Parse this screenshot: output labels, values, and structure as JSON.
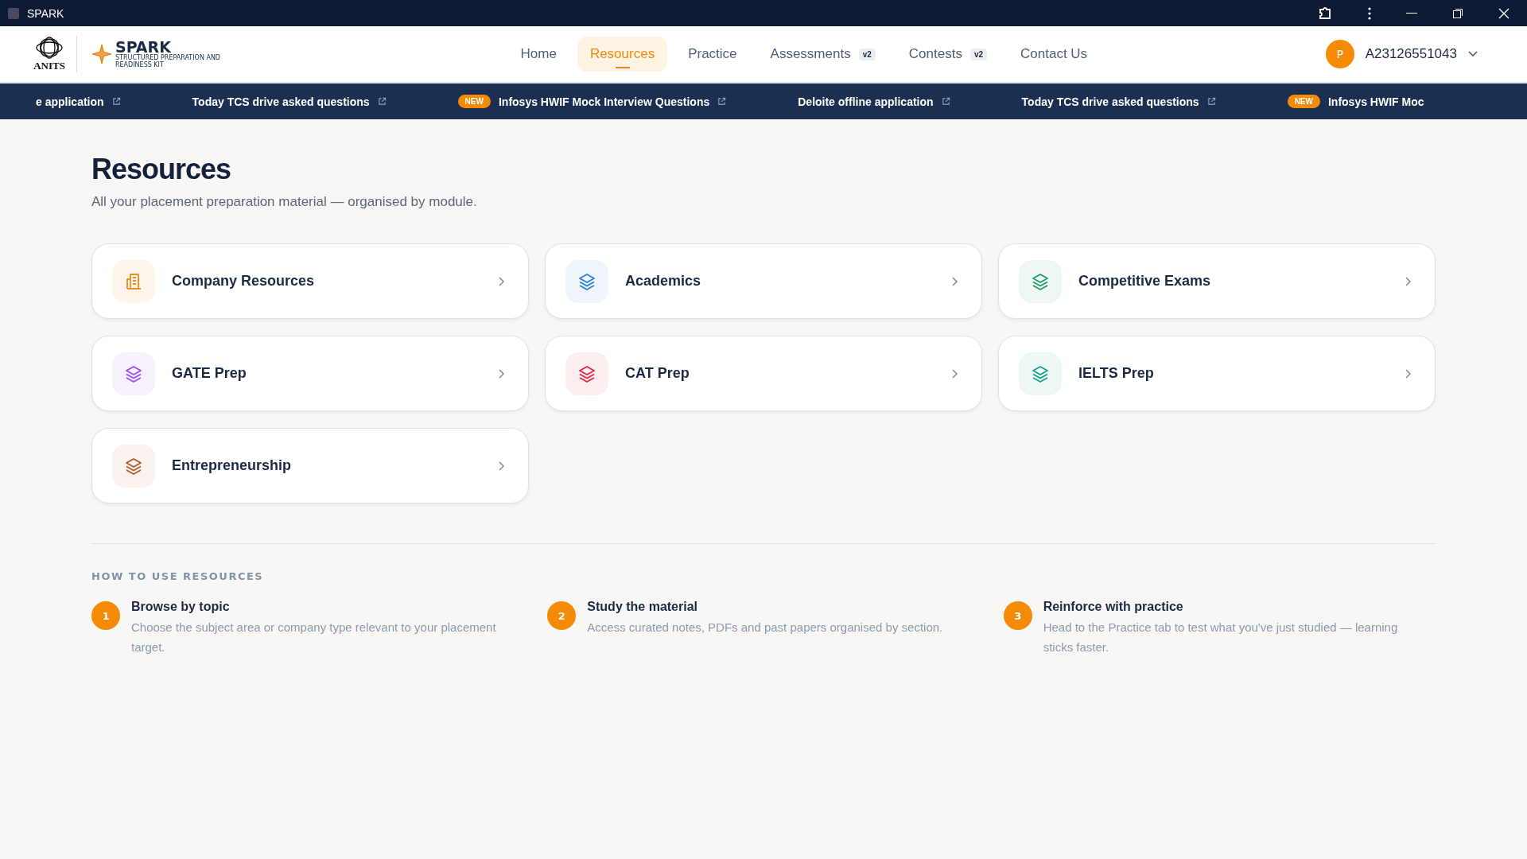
{
  "window": {
    "title": "SPARK"
  },
  "header": {
    "logo_text": "ANITS",
    "brand": "SPARK",
    "brand_tagline": "STRUCTURED PREPARATION AND READINESS KIT",
    "nav": [
      {
        "label": "Home",
        "selected": false
      },
      {
        "label": "Resources",
        "selected": true
      },
      {
        "label": "Practice",
        "selected": false
      },
      {
        "label": "Assessments",
        "selected": false,
        "badge": "v2"
      },
      {
        "label": "Contests",
        "selected": false,
        "badge": "v2"
      },
      {
        "label": "Contact Us",
        "selected": false
      }
    ],
    "user": {
      "initial": "P",
      "id": "A23126551043"
    }
  },
  "ticker": [
    {
      "text": "e application",
      "new": false,
      "link": true
    },
    {
      "text": "Today TCS drive asked questions",
      "new": false,
      "link": true
    },
    {
      "text": "Infosys HWIF Mock Interview Questions",
      "new": true,
      "badge": "NEW",
      "link": true
    },
    {
      "text": "Deloite offline application",
      "new": false,
      "link": true
    },
    {
      "text": "Today TCS drive asked questions",
      "new": false,
      "link": true
    },
    {
      "text": "Infosys HWIF Moc",
      "new": true,
      "badge": "NEW",
      "link": false
    }
  ],
  "page": {
    "title": "Resources",
    "subtitle": "All your placement preparation material — organised by module."
  },
  "modules": [
    {
      "label": "Company Resources",
      "kind": "building",
      "color": "#f08c1a"
    },
    {
      "label": "Academics",
      "kind": "layers",
      "color": "#2a7de1"
    },
    {
      "label": "Competitive Exams",
      "kind": "layers",
      "color": "#1f9d62"
    },
    {
      "label": "GATE Prep",
      "kind": "layers",
      "color": "#9b4de8"
    },
    {
      "label": "CAT Prep",
      "kind": "layers",
      "color": "#e0283e"
    },
    {
      "label": "IELTS Prep",
      "kind": "layers",
      "color": "#14a08c"
    },
    {
      "label": "Entrepreneurship",
      "kind": "layers",
      "color": "#b05a2a"
    }
  ],
  "how_to": {
    "heading": "HOW TO USE RESOURCES",
    "steps": [
      {
        "number": "1",
        "title": "Browse by topic",
        "text": "Choose the subject area or company type relevant to your placement target."
      },
      {
        "number": "2",
        "title": "Study the material",
        "text": "Access curated notes, PDFs and past papers organised by section."
      },
      {
        "number": "3",
        "title": "Reinforce with practice",
        "text": "Head to the Practice tab to test what you've just studied — learning sticks faster."
      }
    ]
  }
}
